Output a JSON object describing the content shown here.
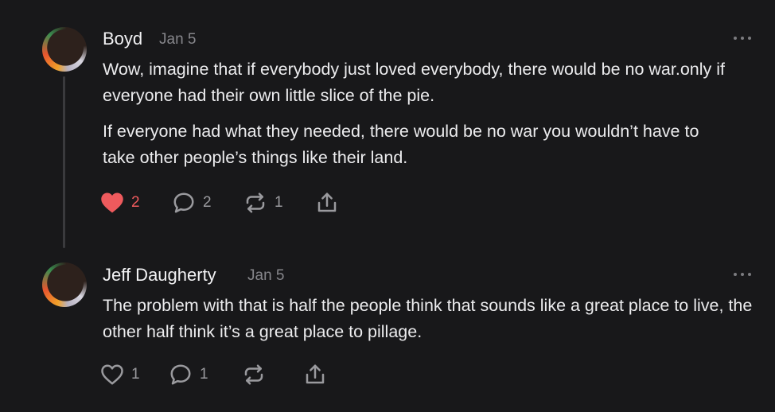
{
  "colors": {
    "background": "#18181a",
    "text_primary": "#ececee",
    "text_secondary": "#86868b",
    "like_active": "#ee5a5d",
    "icon": "#9a9a9e"
  },
  "comments": [
    {
      "author": "Boyd",
      "date": "Jan 5",
      "paragraphs": [
        "Wow, imagine that if everybody just loved everybody, there would be no war.only if everyone had their own little slice of the pie.",
        "If everyone had what they needed, there would be no war you wouldn’t have to take other people’s things like their land."
      ],
      "actions": {
        "like": {
          "icon": "heart-filled",
          "liked": true,
          "count": "2"
        },
        "reply": {
          "icon": "speech-bubble",
          "count": "2"
        },
        "restack": {
          "icon": "restack-arrows",
          "count": "1"
        },
        "share": {
          "icon": "share-upload"
        }
      },
      "menu_icon": "more-dots"
    },
    {
      "author": "Jeff Daugherty",
      "date": "Jan 5",
      "paragraphs": [
        "The problem with that is half the people think that sounds like a great place to live, the other half think it’s a great place to pillage."
      ],
      "actions": {
        "like": {
          "icon": "heart-outline",
          "liked": false,
          "count": "1"
        },
        "reply": {
          "icon": "speech-bubble",
          "count": "1"
        },
        "restack": {
          "icon": "restack-arrows"
        },
        "share": {
          "icon": "share-upload"
        }
      },
      "menu_icon": "more-dots"
    }
  ]
}
